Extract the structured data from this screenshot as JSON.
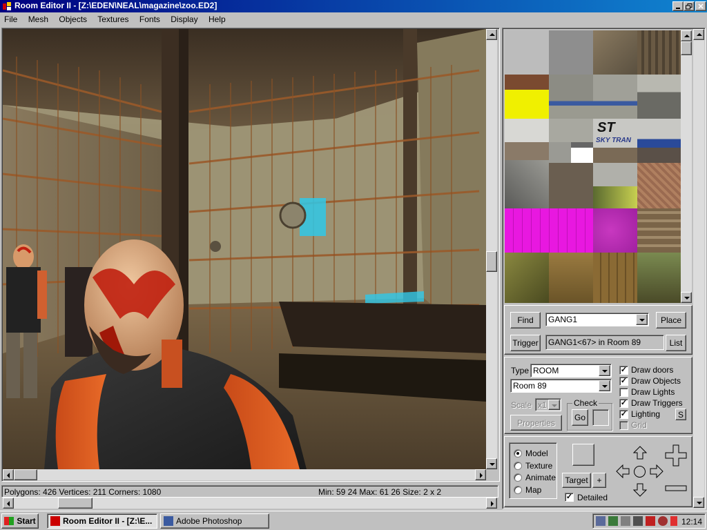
{
  "window": {
    "title": "Room Editor II - [Z:\\EDEN\\NEAL\\magazine\\zoo.ED2]"
  },
  "menu": [
    "File",
    "Mesh",
    "Objects",
    "Textures",
    "Fonts",
    "Display",
    "Help"
  ],
  "statusbar": {
    "left": "Polygons: 426  Vertices: 211  Corners: 1080",
    "right": "Min: 59 24  Max: 61 26  Size: 2 x 2"
  },
  "find": {
    "label": "Find",
    "value": "GANG1",
    "place_label": "Place"
  },
  "trigger": {
    "label": "Trigger",
    "value": "GANG1<67> in Room 89",
    "list_label": "List"
  },
  "settings": {
    "type_label": "Type",
    "type_value": "ROOM",
    "room_value": "Room 89",
    "scale_label": "Scale",
    "scale_value": "x1",
    "check_label": "Check",
    "go_label": "Go",
    "properties_label": "Properties",
    "s_label": "S"
  },
  "draw_options": [
    {
      "label": "Draw doors",
      "checked": true,
      "mark": "✓"
    },
    {
      "label": "Draw Objects",
      "checked": true,
      "mark": "✓"
    },
    {
      "label": "Draw Lights",
      "checked": false,
      "mark": ""
    },
    {
      "label": "Draw Triggers",
      "checked": true,
      "mark": "✓"
    },
    {
      "label": "Lighting",
      "checked": true,
      "mark": "✓"
    },
    {
      "label": "Grid",
      "checked": false,
      "mark": "",
      "disabled": true
    }
  ],
  "mode": {
    "options": [
      "Model",
      "Texture",
      "Animate",
      "Map"
    ],
    "selected": "Model",
    "target_label": "Target",
    "plus_label": "+",
    "detailed_label": "Detailed",
    "detailed_checked": true,
    "detailed_mark": "✓"
  },
  "textures": {
    "sky_logo_top": "ST",
    "sky_logo_bottom": "SKY TRAN"
  },
  "taskbar": {
    "start": "Start",
    "items": [
      "Room Editor II - [Z:\\E...",
      "Adobe Photoshop"
    ],
    "clock": "12:14"
  }
}
